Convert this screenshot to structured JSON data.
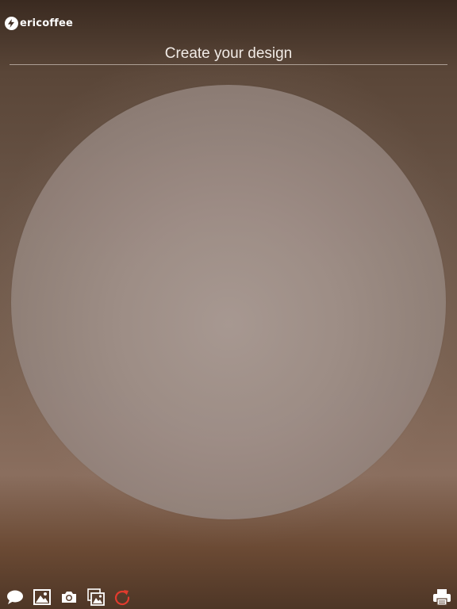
{
  "brand": {
    "name": "ericoffee",
    "logo_icon": "lightning-circle-icon"
  },
  "header": {
    "title": "Create your design"
  },
  "canvas": {
    "shape": "circle",
    "icon": "design-circle"
  },
  "toolbar": {
    "items": [
      {
        "name": "text-tool-button",
        "icon": "speech-bubble-icon"
      },
      {
        "name": "image-tool-button",
        "icon": "picture-icon"
      },
      {
        "name": "camera-tool-button",
        "icon": "camera-icon"
      },
      {
        "name": "gallery-tool-button",
        "icon": "gallery-icon"
      },
      {
        "name": "reset-button",
        "icon": "refresh-icon",
        "color": "#e23b2e"
      },
      {
        "name": "print-button",
        "icon": "printer-icon"
      }
    ]
  },
  "colors": {
    "text": "#ffffff",
    "accent_reset": "#e23b2e"
  }
}
